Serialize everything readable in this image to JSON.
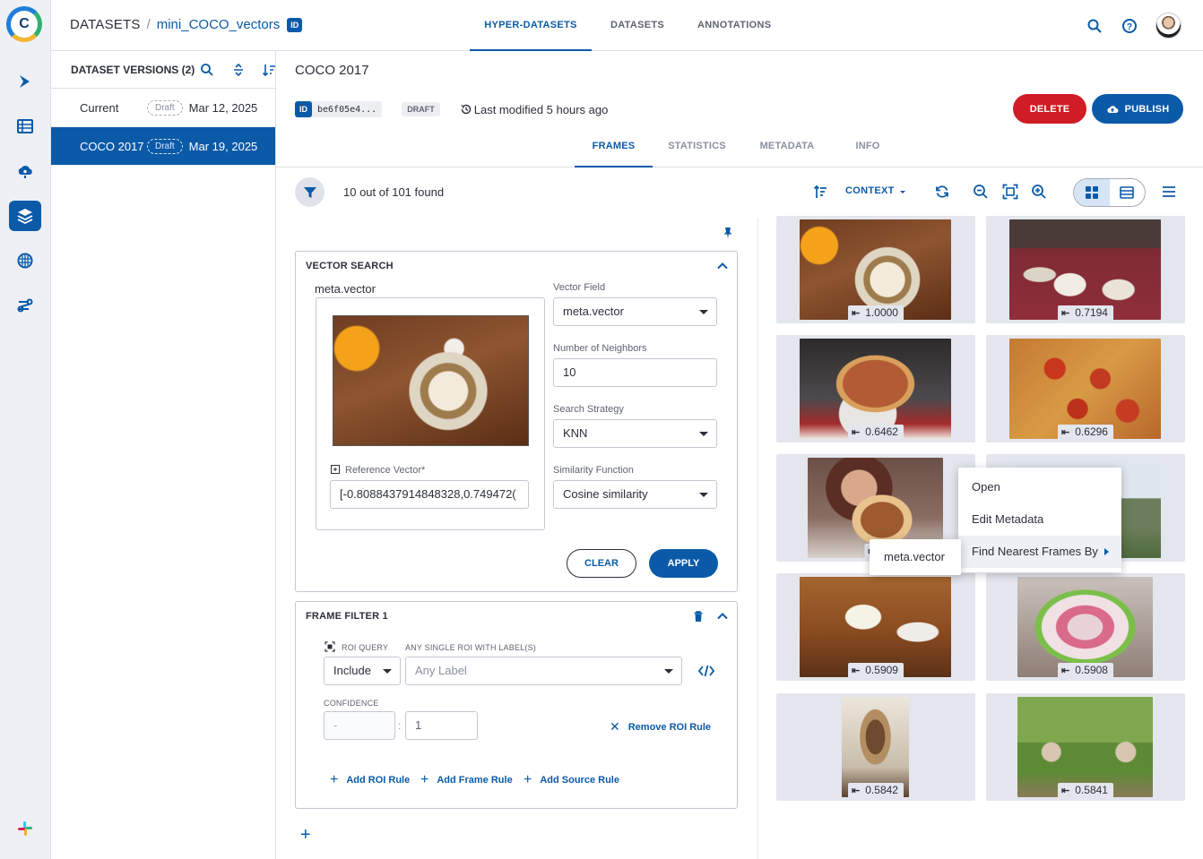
{
  "app": {
    "logo_letter": "C",
    "accent": "#0b5aa8",
    "danger": "#d01c24"
  },
  "rail": {
    "items": [
      "pipelines-icon",
      "tables-icon",
      "cloud-icon",
      "datasets-icon",
      "brain-icon",
      "orchestration-icon"
    ],
    "slack": "slack-icon"
  },
  "header": {
    "breadcrumb_root": "DATASETS",
    "breadcrumb_sep": "/",
    "breadcrumb_name": "mini_COCO_vectors",
    "id_badge": "ID",
    "tabs": [
      "HYPER-DATASETS",
      "DATASETS",
      "ANNOTATIONS"
    ],
    "active_tab": "HYPER-DATASETS"
  },
  "versions": {
    "title": "DATASET VERSIONS (2)",
    "rows": [
      {
        "name": "Current",
        "status": "Draft",
        "date": "Mar 12, 2025",
        "selected": false
      },
      {
        "name": "COCO 2017",
        "status": "Draft",
        "date": "Mar 19, 2025",
        "selected": true
      }
    ]
  },
  "main": {
    "title": "COCO 2017",
    "id_tag": "ID",
    "id_hash": "be6f05e4...",
    "status": "DRAFT",
    "modified": "Last modified 5 hours ago",
    "delete_label": "DELETE",
    "publish_label": "PUBLISH",
    "sub_tabs": [
      "FRAMES",
      "STATISTICS",
      "METADATA",
      "INFO"
    ],
    "active_sub_tab": "FRAMES",
    "found_text": "10 out of 101 found",
    "context_label": "CONTEXT"
  },
  "vector_search": {
    "title": "VECTOR SEARCH",
    "image_field": "meta.vector",
    "vector_field_label": "Vector Field",
    "vector_field_value": "meta.vector",
    "neighbors_label": "Number of Neighbors",
    "neighbors_value": "10",
    "strategy_label": "Search Strategy",
    "strategy_value": "KNN",
    "similarity_label": "Similarity Function",
    "similarity_value": "Cosine similarity",
    "reference_label": "Reference Vector*",
    "reference_value": "[-0.8088437914848328,0.749472(",
    "clear_label": "CLEAR",
    "apply_label": "APPLY"
  },
  "frame_filter": {
    "title": "FRAME FILTER 1",
    "roi_query_label": "ROI QUERY",
    "roi_label_label": "ANY SINGLE ROI WITH LABEL(S)",
    "include_value": "Include",
    "label_placeholder": "Any Label",
    "confidence_label": "CONFIDENCE",
    "conf_min": "-",
    "conf_sep": ":",
    "conf_max": "1",
    "remove_label": "Remove ROI Rule",
    "add_roi": "Add ROI Rule",
    "add_frame": "Add Frame Rule",
    "add_source": "Add Source Rule"
  },
  "frames": [
    {
      "score": "1.0000"
    },
    {
      "score": "0.7194"
    },
    {
      "score": "0.6462"
    },
    {
      "score": "0.6296"
    },
    {
      "score": ""
    },
    {
      "score": ""
    },
    {
      "score": "0.5909"
    },
    {
      "score": "0.5908"
    },
    {
      "score": "0.5842"
    },
    {
      "score": "0.5841"
    }
  ],
  "context_menu": {
    "items": [
      "Open",
      "Edit Metadata",
      "Find Nearest Frames By"
    ],
    "submenu": "meta.vector"
  }
}
